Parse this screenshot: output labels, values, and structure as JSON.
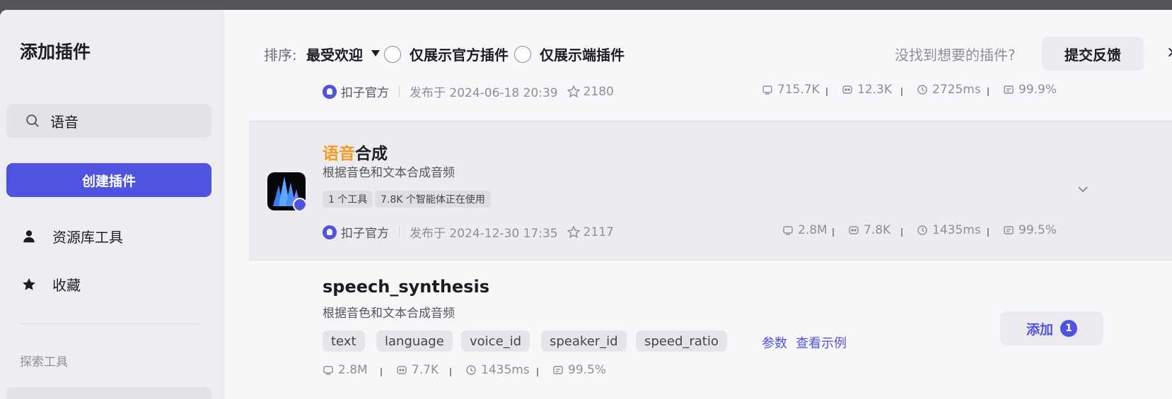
{
  "sidebar": {
    "title": "添加插件",
    "search": {
      "value": "语音",
      "placeholder": ""
    },
    "create_button": "创建插件",
    "nav": [
      {
        "label": "资源库工具",
        "icon": "user-icon"
      },
      {
        "label": "收藏",
        "icon": "star-icon"
      }
    ],
    "section_label": "探索工具"
  },
  "toolbar": {
    "sort_label": "排序:",
    "sort_value": "最受欢迎",
    "filters": [
      {
        "label": "仅展示官方插件",
        "checked": false
      },
      {
        "label": "仅展示端插件",
        "checked": false
      }
    ],
    "feedback_hint": "没找到想要的插件?",
    "feedback_button": "提交反馈"
  },
  "plugins": [
    {
      "author": "扣子官方",
      "published": "发布于 2024-06-18 20:39",
      "favorites": "2180",
      "stats": [
        "715.7K",
        "12.3K",
        "2725ms",
        "99.9%"
      ]
    },
    {
      "title_highlight": "语音",
      "title_rest": "合成",
      "description": "根据音色和文本合成音频",
      "tags": [
        "1 个工具",
        "7.8K 个智能体正在使用"
      ],
      "author": "扣子官方",
      "published": "发布于 2024-12-30 17:35",
      "favorites": "2117",
      "stats": [
        "2.8M",
        "7.8K",
        "1435ms",
        "99.5%"
      ]
    }
  ],
  "tool": {
    "name": "speech_synthesis",
    "description": "根据音色和文本合成音频",
    "params": [
      "text",
      "language",
      "voice_id",
      "speaker_id",
      "speed_ratio"
    ],
    "params_link": "参数",
    "example_link": "查看示例",
    "stats": [
      "2.8M",
      "7.7K",
      "1435ms",
      "99.5%"
    ],
    "add_button": "添加",
    "add_count": "1"
  },
  "colors": {
    "accent": "#4e53e0",
    "highlight": "#f59a23"
  }
}
